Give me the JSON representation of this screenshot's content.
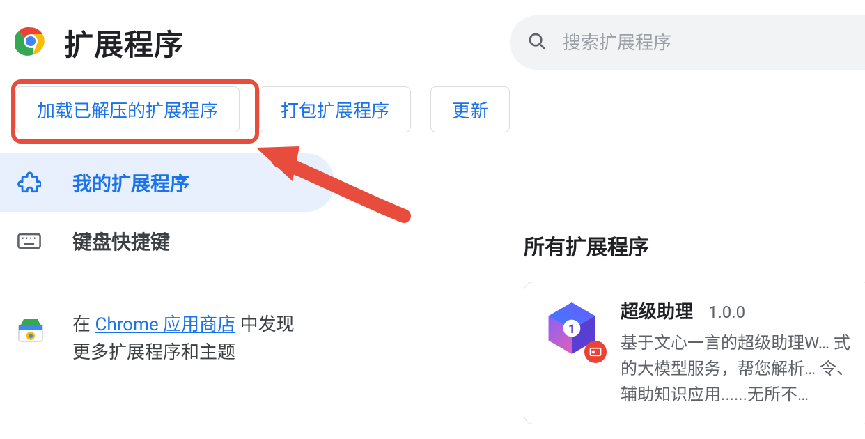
{
  "header": {
    "title": "扩展程序"
  },
  "search": {
    "placeholder": "搜索扩展程序",
    "value": ""
  },
  "toolbar": {
    "load_unpacked_label": "加载已解压的扩展程序",
    "pack_label": "打包扩展程序",
    "update_label": "更新"
  },
  "sidebar": {
    "items": [
      {
        "label": "我的扩展程序",
        "icon": "extension-icon",
        "active": true
      },
      {
        "label": "键盘快捷键",
        "icon": "keyboard-icon",
        "active": false
      }
    ],
    "webstore": {
      "prefix": "在 ",
      "link_text": "Chrome 应用商店",
      "suffix": " 中发现",
      "line2": "更多扩展程序和主题"
    }
  },
  "main": {
    "section_title": "所有扩展程序",
    "extensions": [
      {
        "name": "超级助理",
        "version": "1.0.0",
        "description": "基于文心一言的超级助理W… 式的大模型服务，帮您解析… 令、辅助知识应用......无所不…"
      }
    ]
  },
  "colors": {
    "primary": "#1a73e8",
    "highlight": "#e74c3c",
    "text_muted": "#5f6368"
  }
}
